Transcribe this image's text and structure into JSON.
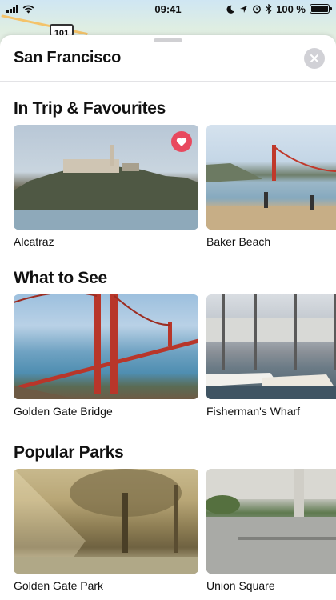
{
  "status_bar": {
    "time": "09:41",
    "battery_text": "100 %",
    "battery_level": 1.0
  },
  "map": {
    "road_shield": "101"
  },
  "sheet": {
    "title": "San Francisco",
    "close_icon": "close-circle-icon"
  },
  "sections": [
    {
      "title": "In Trip & Favourites",
      "cards": [
        {
          "label": "Alcatraz",
          "favourite": true
        },
        {
          "label": "Baker Beach",
          "favourite": false
        }
      ]
    },
    {
      "title": "What to See",
      "cards": [
        {
          "label": "Golden Gate Bridge"
        },
        {
          "label": "Fisherman's Wharf"
        }
      ]
    },
    {
      "title": "Popular Parks",
      "cards": [
        {
          "label": "Golden Gate Park"
        },
        {
          "label": "Union Square"
        }
      ]
    }
  ],
  "colors": {
    "favourite_badge": "#e8495e",
    "bridge": "#c0392b"
  }
}
